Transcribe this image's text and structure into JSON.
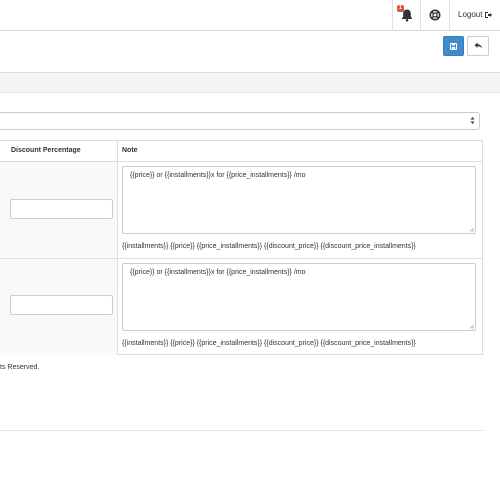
{
  "header": {
    "notification_count": "1",
    "logout_label": "Logout"
  },
  "table": {
    "columns": [
      "Discount Percentage",
      "Note"
    ],
    "rows": [
      {
        "discount_percentage": "",
        "note": "{{price}} or {{installments}}x for {{price_installments}} /mo",
        "variables": "{{installments}} {{price}} {{price_installments}} {{discount_price}} {{discount_price_installments}}"
      },
      {
        "discount_percentage": "",
        "note": "{{price}} or {{installments}}x for {{price_installments}} /mo",
        "variables": "{{installments}} {{price}} {{price_installments}} {{discount_price}} {{discount_price_installments}}"
      }
    ]
  },
  "footer": {
    "text": "ts Reserved."
  },
  "colors": {
    "primary": "#428bca",
    "badge": "#d9534f"
  }
}
